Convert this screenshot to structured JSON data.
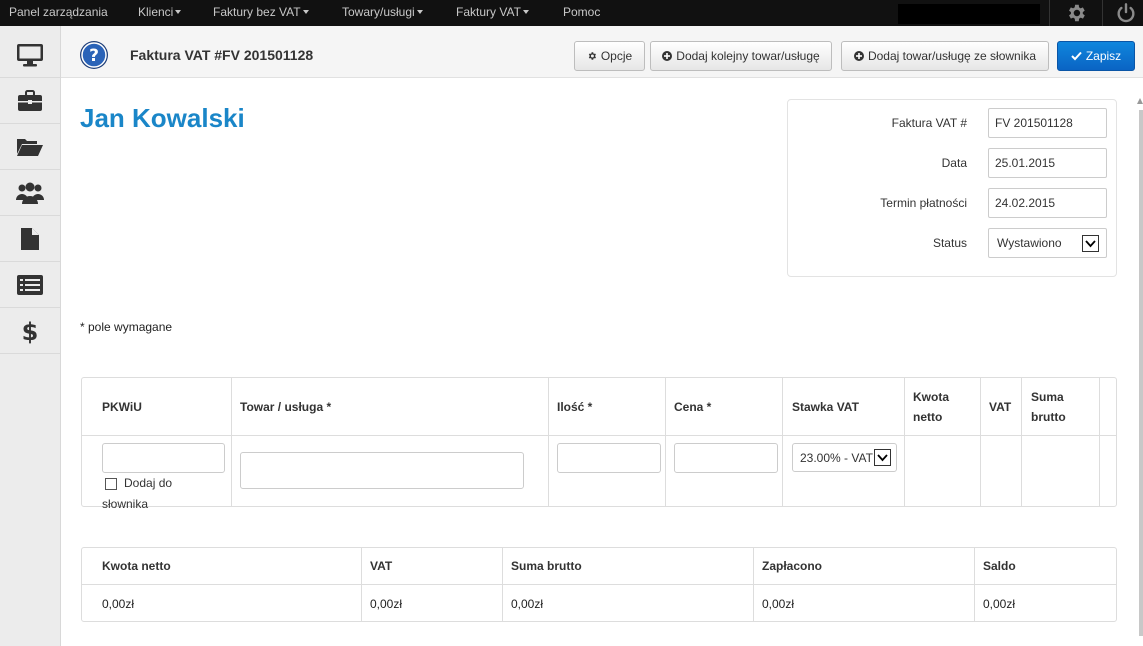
{
  "nav": {
    "items": [
      {
        "label": "Panel zarządzania",
        "dropdown": false
      },
      {
        "label": "Klienci",
        "dropdown": true
      },
      {
        "label": "Faktury bez VAT",
        "dropdown": true
      },
      {
        "label": "Towary/usługi",
        "dropdown": true
      },
      {
        "label": "Faktury VAT",
        "dropdown": true
      },
      {
        "label": "Pomoc",
        "dropdown": false
      }
    ],
    "icons": [
      "gear-icon",
      "power-icon"
    ]
  },
  "sidebar": {
    "icons": [
      "monitor-icon",
      "briefcase-icon",
      "folder-open-icon",
      "users-icon",
      "file-icon",
      "list-icon",
      "dollar-icon"
    ]
  },
  "header": {
    "title": "Faktura VAT #FV 201501128",
    "buttons": {
      "options": "Opcje",
      "add_item": "Dodaj kolejny towar/usługę",
      "add_from_dict": "Dodaj towar/usługę ze słownika",
      "save": "Zapisz"
    }
  },
  "client": {
    "name": "Jan Kowalski"
  },
  "invoice": {
    "number_label": "Faktura VAT #",
    "number_value": "FV 201501128",
    "date_label": "Data",
    "date_value": "25.01.2015",
    "due_label": "Termin płatności",
    "due_value": "24.02.2015",
    "status_label": "Status",
    "status_value": "Wystawiono"
  },
  "required_note": "* pole wymagane",
  "items_table": {
    "headers": {
      "pkwiu": "PKWiU",
      "product": "Towar / usługa *",
      "qty": "Ilość *",
      "price": "Cena *",
      "vat_rate": "Stawka VAT",
      "net_1": "Kwota",
      "net_2": "netto",
      "vat": "VAT",
      "gross_1": "Suma",
      "gross_2": "brutto"
    },
    "row": {
      "add_to_dict_1": "Dodaj do",
      "add_to_dict_2": "słownika",
      "vat_rate_value": "23.00% - VAT"
    }
  },
  "summary": {
    "headers": [
      "Kwota netto",
      "VAT",
      "Suma brutto",
      "Zapłacono",
      "Saldo"
    ],
    "values": [
      "0,00zł",
      "0,00zł",
      "0,00zł",
      "0,00zł",
      "0,00zł"
    ]
  }
}
